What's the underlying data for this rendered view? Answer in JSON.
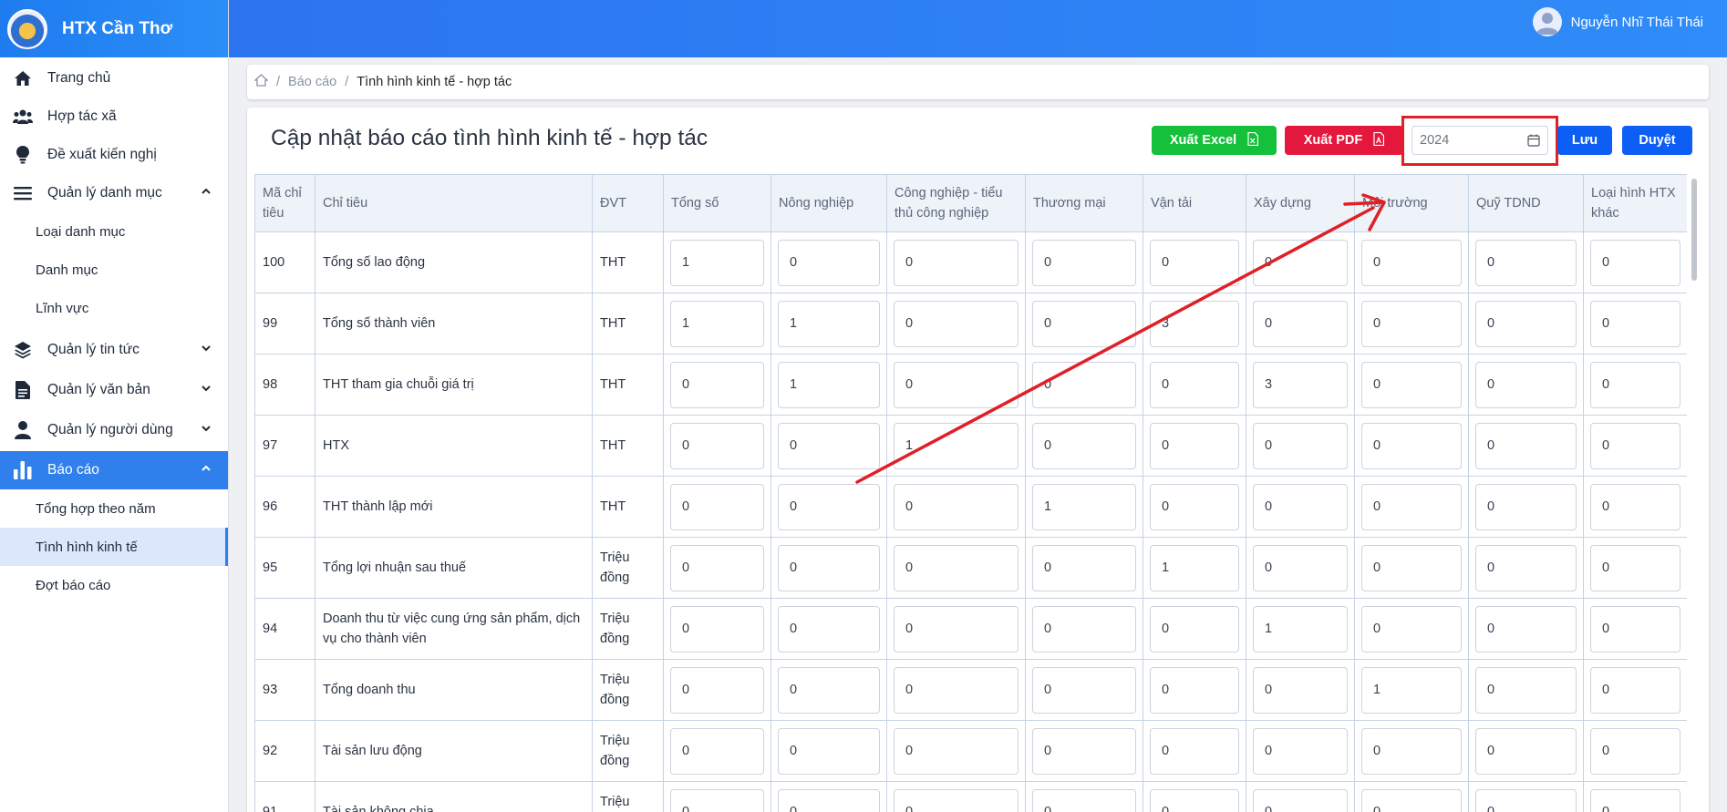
{
  "brand": {
    "title": "HTX Cần Thơ"
  },
  "user": {
    "name": "Nguyễn Nhĩ Thái Thái"
  },
  "sidebar": {
    "items": [
      {
        "label": "Trang chủ"
      },
      {
        "label": "Hợp tác xã"
      },
      {
        "label": "Đề xuất kiến nghị"
      },
      {
        "label": "Quản lý danh mục"
      },
      {
        "label": "Loại danh mục"
      },
      {
        "label": "Danh mục"
      },
      {
        "label": "Lĩnh vực"
      },
      {
        "label": "Quản lý tin tức"
      },
      {
        "label": "Quản lý văn bản"
      },
      {
        "label": "Quản lý người dùng"
      },
      {
        "label": "Báo cáo"
      },
      {
        "label": "Tổng hợp theo năm"
      },
      {
        "label": "Tình hình kinh tế"
      },
      {
        "label": "Đợt báo cáo"
      }
    ]
  },
  "breadcrumb": {
    "reports": "Báo cáo",
    "current": "Tình hình kinh tế - hợp tác"
  },
  "page": {
    "title": "Cập nhật báo cáo tình hình kinh tế - hợp tác",
    "export_excel": "Xuất Excel",
    "export_pdf": "Xuất PDF",
    "year": "2024",
    "save": "Lưu",
    "approve": "Duyệt"
  },
  "colors": {
    "primary": "#2f80ed",
    "excel": "#15c13b",
    "pdf": "#e4183d",
    "annotation": "#e01f27"
  },
  "table": {
    "headers": [
      "Mã chỉ tiêu",
      "Chỉ tiêu",
      "ĐVT",
      "Tổng số",
      "Nông nghiệp",
      "Công nghiệp - tiểu thủ công nghiệp",
      "Thương mại",
      "Vận tải",
      "Xây dựng",
      "Môi trường",
      "Quỹ TDND",
      "Loại hình HTX khác"
    ],
    "rows": [
      {
        "code": "100",
        "name": "Tổng số lao động",
        "unit": "THT",
        "values": [
          "1",
          "0",
          "0",
          "0",
          "0",
          "0",
          "0",
          "0",
          "0"
        ]
      },
      {
        "code": "99",
        "name": "Tổng số thành viên",
        "unit": "THT",
        "values": [
          "1",
          "1",
          "0",
          "0",
          "3",
          "0",
          "0",
          "0",
          "0"
        ]
      },
      {
        "code": "98",
        "name": "THT tham gia chuỗi giá trị",
        "unit": "THT",
        "values": [
          "0",
          "1",
          "0",
          "0",
          "0",
          "3",
          "0",
          "0",
          "0"
        ]
      },
      {
        "code": "97",
        "name": "HTX",
        "unit": "THT",
        "values": [
          "0",
          "0",
          "1",
          "0",
          "0",
          "0",
          "0",
          "0",
          "0"
        ]
      },
      {
        "code": "96",
        "name": "THT thành lập mới",
        "unit": "THT",
        "values": [
          "0",
          "0",
          "0",
          "1",
          "0",
          "0",
          "0",
          "0",
          "0"
        ]
      },
      {
        "code": "95",
        "name": "Tổng lợi nhuận sau thuế",
        "unit": "Triệu đồng",
        "values": [
          "0",
          "0",
          "0",
          "0",
          "1",
          "0",
          "0",
          "0",
          "0"
        ]
      },
      {
        "code": "94",
        "name": "Doanh thu từ việc cung ứng sản phẩm, dịch vụ cho thành viên",
        "unit": "Triệu đồng",
        "values": [
          "0",
          "0",
          "0",
          "0",
          "0",
          "1",
          "0",
          "0",
          "0"
        ]
      },
      {
        "code": "93",
        "name": "Tổng doanh thu",
        "unit": "Triệu đồng",
        "values": [
          "0",
          "0",
          "0",
          "0",
          "0",
          "0",
          "1",
          "0",
          "0"
        ]
      },
      {
        "code": "92",
        "name": "Tài sản lưu động",
        "unit": "Triệu đồng",
        "values": [
          "0",
          "0",
          "0",
          "0",
          "0",
          "0",
          "0",
          "0",
          "0"
        ]
      },
      {
        "code": "91",
        "name": "Tài sản không chia",
        "unit": "Triệu đồng",
        "values": [
          "0",
          "0",
          "0",
          "0",
          "0",
          "0",
          "0",
          "0",
          "0"
        ]
      }
    ]
  }
}
